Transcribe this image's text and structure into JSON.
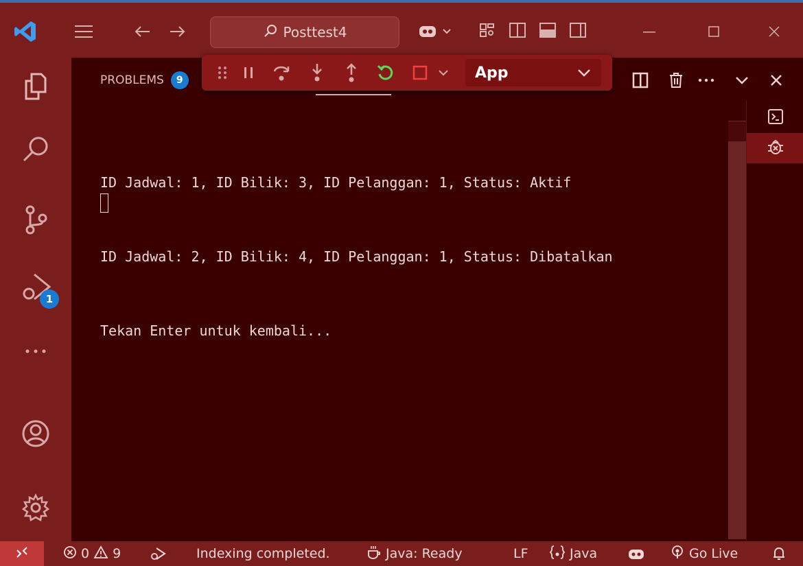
{
  "title_bar": {
    "search_text": "Posttest4"
  },
  "activity_bar": {
    "run_debug_badge": "1"
  },
  "panel": {
    "problems_label": "PROBLEMS",
    "problems_count": "9"
  },
  "debug_toolbar": {
    "launch_config": "App"
  },
  "terminal": {
    "lines": [
      "ID Jadwal: 1, ID Bilik: 3, ID Pelanggan: 1, Status: Aktif",
      "ID Jadwal: 2, ID Bilik: 4, ID Pelanggan: 1, Status: Dibatalkan",
      "Tekan Enter untuk kembali..."
    ]
  },
  "status_bar": {
    "errors": "0",
    "warnings": "9",
    "indexing": "Indexing completed.",
    "java_status": "Java: Ready",
    "eol": "LF",
    "language": "Java",
    "go_live": "Go Live"
  },
  "colors": {
    "chrome": "#7a1d1d",
    "editor_bg": "#3a0000",
    "badge": "#1a7cd0",
    "restart_green": "#5cd65c"
  }
}
